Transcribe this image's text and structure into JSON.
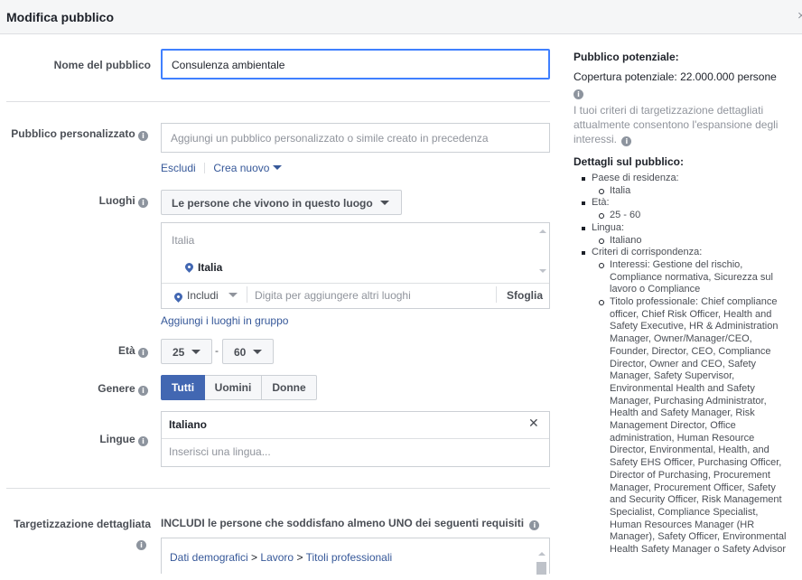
{
  "dialog": {
    "title": "Modifica pubblico",
    "close_label": "×"
  },
  "audience_name": {
    "label": "Nome del pubblico",
    "value": "Consulenza ambientale"
  },
  "custom_audience": {
    "label": "Pubblico personalizzato",
    "placeholder": "Aggiungi un pubblico personalizzato o simile creato in precedenza",
    "exclude_link": "Escludi",
    "create_new_link": "Crea nuovo"
  },
  "locations": {
    "label": "Luoghi",
    "type_dropdown": "Le persone che vivono in questo luogo",
    "group_header": "Italia",
    "selected_item": "Italia",
    "include_dropdown": "Includi",
    "search_placeholder": "Digita per aggiungere altri luoghi",
    "browse_button": "Sfoglia",
    "bulk_link": "Aggiungi i luoghi in gruppo"
  },
  "age": {
    "label": "Età",
    "min": "25",
    "separator": "-",
    "max": "60"
  },
  "gender": {
    "label": "Genere",
    "options": [
      "Tutti",
      "Uomini",
      "Donne"
    ],
    "selected": "Tutti"
  },
  "languages": {
    "label": "Lingue",
    "selected": "Italiano",
    "remove_label": "✕",
    "placeholder": "Inserisci una lingua..."
  },
  "detailed_targeting": {
    "label": "Targetizzazione dettagliata",
    "include_text": "INCLUDI le persone che soddisfano almeno UNO dei seguenti requisiti",
    "breadcrumb": [
      "Dati demografici",
      "Lavoro",
      "Titoli professionali"
    ],
    "breadcrumb_sep": ">"
  },
  "summary": {
    "potential_title": "Pubblico potenziale:",
    "potential_reach": "Copertura potenziale: 22.000.000 persone",
    "note": "I tuoi criteri di targetizzazione dettagliati attualmente consentono l'espansione degli interessi.",
    "details_title": "Dettagli sul pubblico:",
    "residence_label": "Paese di residenza:",
    "residence_value": "Italia",
    "age_label": "Età:",
    "age_value": "25 - 60",
    "language_label": "Lingua:",
    "language_value": "Italiano",
    "criteria_label": "Criteri di corrispondenza:",
    "interests": "Interessi: Gestione del rischio, Compliance normativa, Sicurezza sul lavoro o Compliance",
    "job_titles": "Titolo professionale: Chief compliance officer, Chief Risk Officer, Health and Safety Executive, HR & Administration Manager, Owner/Manager/CEO, Founder, Director, CEO, Compliance Director, Owner and CEO, Safety Manager, Safety Supervisor, Environmental Health and Safety Manager, Purchasing Administrator, Health and Safety Manager, Risk Management Director, Office administration, Human Resource Director, Environmental, Health, and Safety EHS Officer, Purchasing Officer, Director of Purchasing, Procurement Manager, Procurement Officer, Safety and Security Officer, Risk Management Specialist, Compliance Specialist, Human Resources Manager (HR Manager), Safety Officer, Environmental Health Safety Manager o Safety Advisor"
  },
  "colors": {
    "accent": "#4080ff",
    "link": "#365899",
    "selected_button": "#4267b2"
  }
}
